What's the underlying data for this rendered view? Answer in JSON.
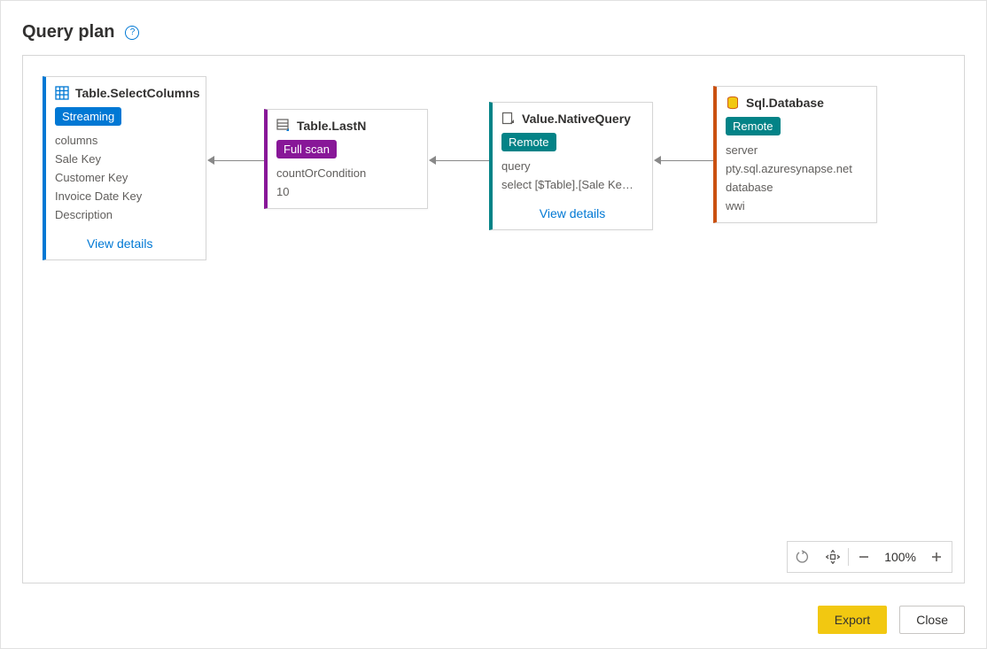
{
  "header": {
    "title": "Query plan"
  },
  "nodes": {
    "n1": {
      "title": "Table.SelectColumns",
      "badge": "Streaming",
      "lines": [
        "columns",
        "Sale Key",
        "Customer Key",
        "Invoice Date Key",
        "Description"
      ],
      "viewdetails": "View details"
    },
    "n2": {
      "title": "Table.LastN",
      "badge": "Full scan",
      "lines": [
        "countOrCondition",
        "10"
      ]
    },
    "n3": {
      "title": "Value.NativeQuery",
      "badge": "Remote",
      "lines": [
        "query",
        "select [$Table].[Sale Ke…"
      ],
      "viewdetails": "View details"
    },
    "n4": {
      "title": "Sql.Database",
      "badge": "Remote",
      "lines": [
        "server",
        "pty.sql.azuresynapse.net",
        "database",
        "wwi"
      ]
    }
  },
  "zoom": {
    "label": "100%"
  },
  "footer": {
    "export": "Export",
    "close": "Close"
  }
}
